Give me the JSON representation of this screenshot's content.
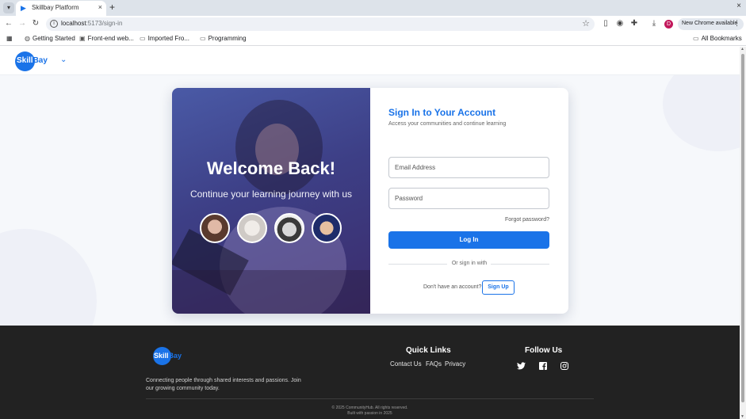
{
  "browser": {
    "tab_title": "Skillbay Platform",
    "tab_close": "×",
    "new_tab": "+",
    "window_close": "×",
    "url_host": "localhost",
    "url_path": ":5173/sign-in",
    "update_label": "New Chrome available",
    "profile_initial": "D",
    "bookmarks": [
      "Getting Started",
      "Front-end web...",
      "Imported Fro...",
      "Programming"
    ],
    "all_bookmarks": "All Bookmarks"
  },
  "header": {
    "logo_part1": "Skill",
    "logo_part2": "Bay",
    "menu_chevron": "⌄"
  },
  "hero": {
    "title": "Welcome Back!",
    "subtitle": "Continue your learning journey with us"
  },
  "signin": {
    "title": "Sign In to Your Account",
    "subtitle": "Access your communities and continue learning",
    "email_placeholder": "Email Address",
    "password_placeholder": "Password",
    "forgot": "Forgot password?",
    "login_label": "Log In",
    "divider": "Or sign in with",
    "no_account": "Don't have an account?",
    "signup_label": "Sign Up"
  },
  "footer": {
    "logo_part1": "Skill",
    "logo_part2": "Bay",
    "description": "Connecting people through shared interests and passions. Join our growing community today.",
    "quick_links_title": "Quick Links",
    "links": [
      "Contact Us",
      "FAQs",
      "Privacy"
    ],
    "follow_title": "Follow Us",
    "social_icons": [
      "twitter-icon",
      "facebook-icon",
      "instagram-icon"
    ],
    "copyright": "© 2025 CommunityHub. All rights reserved.",
    "built_with": "Built with passion in 2025"
  },
  "colors": {
    "brand_blue": "#1a73e8",
    "footer_bg": "#222222",
    "hero_purple": "#3d3f86"
  }
}
